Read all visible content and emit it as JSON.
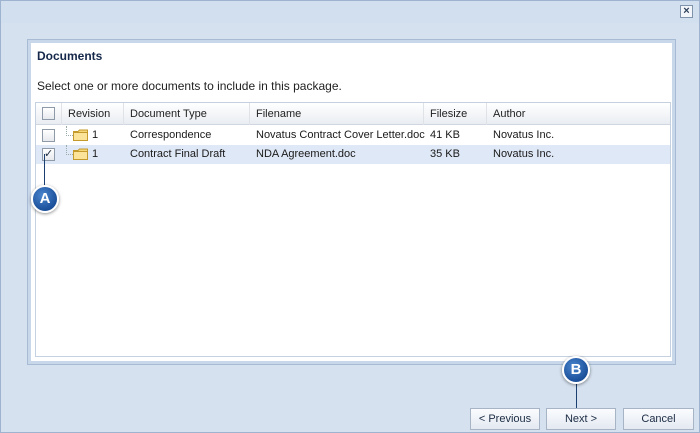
{
  "dialog": {
    "close_glyph": "×"
  },
  "panel": {
    "title": "Documents",
    "instructions": "Select one or more documents to include in this package."
  },
  "grid": {
    "columns": [
      "Revision",
      "Document Type",
      "Filename",
      "Filesize",
      "Author"
    ],
    "rows": [
      {
        "revision": "1",
        "document_type": "Correspondence",
        "filename": "Novatus Contract Cover Letter.doc",
        "filesize": "41 KB",
        "author": "Novatus Inc.",
        "checked": false
      },
      {
        "revision": "1",
        "document_type": "Contract Final Draft",
        "filename": "NDA Agreement.doc",
        "filesize": "35 KB",
        "author": "Novatus Inc.",
        "checked": true
      }
    ]
  },
  "callouts": {
    "a": "A",
    "b": "B"
  },
  "buttons": {
    "previous": "< Previous",
    "next": "Next >",
    "cancel": "Cancel"
  },
  "icons": {
    "close": "close-icon",
    "folder": "folder-icon",
    "checkbox_check": "✓"
  },
  "colors": {
    "selected_row": "#dfe8f6",
    "callout": "#1b4f99",
    "dialog_bg": "#d5e1ef"
  }
}
